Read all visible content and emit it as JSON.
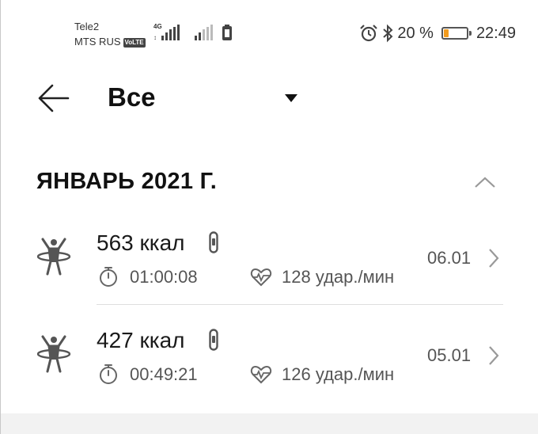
{
  "status_bar": {
    "carrier_1": "Tele2",
    "carrier_2": "MTS RUS",
    "volte_badge": "VoLTE",
    "network_type": "4G",
    "battery_percent_label": "20 %",
    "battery_level": 0.2,
    "time": "22:49",
    "icons": [
      "signal-icon",
      "sim-icon",
      "alarm-icon",
      "bluetooth-icon",
      "battery-icon"
    ]
  },
  "header": {
    "title": "Все",
    "icons": [
      "back-arrow-icon",
      "dropdown-triangle-icon"
    ]
  },
  "section": {
    "month_title": "ЯНВАРЬ 2021 Г.",
    "icon": "chevron-up-icon"
  },
  "workouts": [
    {
      "calories": "563 ккал",
      "duration": "01:00:08",
      "heart_rate": "128 удар./мин",
      "date": "06.01"
    },
    {
      "calories": "427 ккал",
      "duration": "00:49:21",
      "heart_rate": "126 удар./мин",
      "date": "05.01"
    }
  ],
  "colors": {
    "battery_accent": "#f29b1d",
    "text_primary": "#1a1a1a",
    "text_secondary": "#555555"
  }
}
